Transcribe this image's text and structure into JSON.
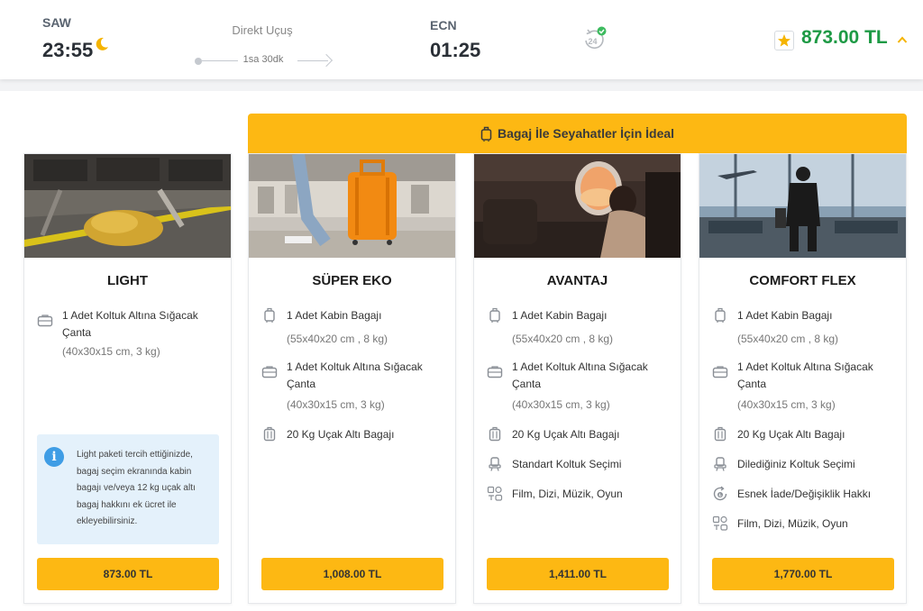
{
  "flight": {
    "departure_code": "SAW",
    "departure_time": "23:55",
    "direct_label": "Direkt Uçuş",
    "duration": "1sa 30dk",
    "arrival_code": "ECN",
    "arrival_time": "01:25",
    "price": "873.00 TL"
  },
  "banner": {
    "text": "Bagaj İle Seyahatler İçin İdeal"
  },
  "packages": [
    {
      "name": "LIGHT",
      "features": [
        {
          "icon": "underseat-bag-icon",
          "text": "1 Adet Koltuk Altına Sığacak Çanta",
          "sub": "(40x30x15 cm, 3 kg)"
        }
      ],
      "info": "Light paketi tercih ettiğinizde, bagaj seçim ekranında kabin bagajı ve/veya 12 kg uçak altı bagaj hakkını ek ücret ile ekleyebilirsiniz.",
      "price": "873.00 TL"
    },
    {
      "name": "SÜPER EKO",
      "features": [
        {
          "icon": "cabin-bag-icon",
          "text": "1 Adet Kabin Bagajı",
          "sub": "(55x40x20 cm , 8 kg)"
        },
        {
          "icon": "underseat-bag-icon",
          "text": "1 Adet Koltuk Altına Sığacak Çanta",
          "sub": "(40x30x15 cm, 3 kg)"
        },
        {
          "icon": "checked-luggage-icon",
          "text": "20 Kg Uçak Altı Bagajı"
        }
      ],
      "price": "1,008.00 TL"
    },
    {
      "name": "AVANTAJ",
      "features": [
        {
          "icon": "cabin-bag-icon",
          "text": "1 Adet Kabin Bagajı",
          "sub": "(55x40x20 cm , 8 kg)"
        },
        {
          "icon": "underseat-bag-icon",
          "text": "1 Adet Koltuk Altına Sığacak Çanta",
          "sub": "(40x30x15 cm, 3 kg)"
        },
        {
          "icon": "checked-luggage-icon",
          "text": "20 Kg Uçak Altı Bagajı"
        },
        {
          "icon": "seat-icon",
          "text": "Standart Koltuk Seçimi"
        },
        {
          "icon": "entertainment-icon",
          "text": "Film, Dizi, Müzik, Oyun"
        }
      ],
      "price": "1,411.00 TL"
    },
    {
      "name": "COMFORT FLEX",
      "features": [
        {
          "icon": "cabin-bag-icon",
          "text": "1 Adet Kabin Bagajı",
          "sub": "(55x40x20 cm , 8 kg)"
        },
        {
          "icon": "underseat-bag-icon",
          "text": "1 Adet Koltuk Altına Sığacak Çanta",
          "sub": "(40x30x15 cm, 3 kg)"
        },
        {
          "icon": "checked-luggage-icon",
          "text": "20 Kg Uçak Altı Bagajı"
        },
        {
          "icon": "seat-icon",
          "text": "Dilediğiniz Koltuk Seçimi"
        },
        {
          "icon": "flexible-refund-icon",
          "text": "Esnek İade/Değişiklik Hakkı"
        },
        {
          "icon": "entertainment-icon",
          "text": "Film, Dizi, Müzik, Oyun"
        }
      ],
      "price": "1,770.00 TL"
    }
  ],
  "colors": {
    "accent": "#fdb813",
    "price_green": "#1e9a45",
    "info_bg": "#e4f1fb",
    "info_icon": "#3f9de5"
  }
}
